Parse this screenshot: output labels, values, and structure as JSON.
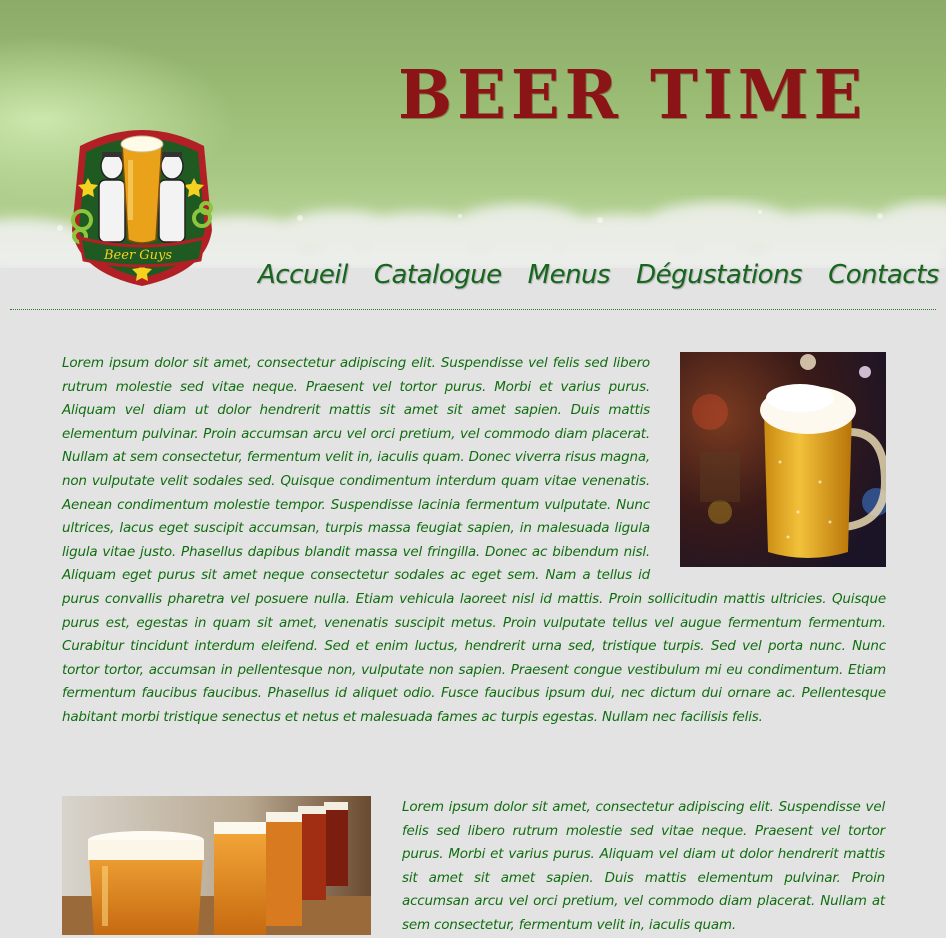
{
  "header": {
    "title": "BEER TIME",
    "logo": {
      "icon": "beer-guys-logo",
      "text": "Beer Guys"
    }
  },
  "nav": {
    "items": [
      {
        "label": "Accueil"
      },
      {
        "label": "Catalogue"
      },
      {
        "label": "Menus"
      },
      {
        "label": "Dégustations"
      },
      {
        "label": "Contacts"
      }
    ]
  },
  "content": {
    "paragraph1": "Lorem ipsum dolor sit amet, consectetur adipiscing elit. Suspendisse vel felis sed libero rutrum molestie sed vitae neque. Praesent vel tortor purus. Morbi et varius purus. Aliquam vel diam ut dolor hendrerit mattis sit amet sit amet sapien. Duis mattis elementum pulvinar. Proin accumsan arcu vel orci pretium, vel commodo diam placerat. Nullam at sem consectetur, fermentum velit in, iaculis quam. Donec viverra risus magna, non vulputate velit sodales sed. Quisque condimentum interdum quam vitae venenatis. Aenean condimentum molestie tempor. Suspendisse lacinia fermentum vulputate. Nunc ultrices, lacus eget suscipit accumsan, turpis massa feugiat sapien, in malesuada ligula ligula vitae justo. Phasellus dapibus blandit massa vel fringilla. Donec ac bibendum nisl. Aliquam eget purus sit amet neque consectetur sodales ac eget sem. Nam a tellus id purus convallis pharetra vel posuere nulla. Etiam vehicula laoreet nisl id mattis. Proin sollicitudin mattis ultricies. Quisque purus est, egestas in quam sit amet, venenatis suscipit metus. Proin vulputate tellus vel augue fermentum fermentum. Curabitur tincidunt interdum eleifend. Sed et enim luctus, hendrerit urna sed, tristique turpis. Sed vel porta nunc. Nunc tortor tortor, accumsan in pellentesque non, vulputate non sapien. Praesent congue vestibulum mi eu condimentum. Etiam fermentum faucibus faucibus. Phasellus id aliquet odio. Fusce faucibus ipsum dui, nec dictum dui ornare ac. Pellentesque habitant morbi tristique senectus et netus et malesuada fames ac turpis egestas. Nullam nec facilisis felis.",
    "paragraph2": "Lorem ipsum dolor sit amet, consectetur adipiscing elit. Suspendisse vel felis sed libero rutrum molestie sed vitae neque. Praesent vel tortor purus. Morbi et varius purus. Aliquam vel diam ut dolor hendrerit mattis sit amet sit amet sapien. Duis mattis elementum pulvinar. Proin accumsan arcu vel orci pretium, vel commodo diam placerat. Nullam at sem consectetur, fermentum velit in, iaculis quam.",
    "image1": {
      "icon": "beer-mug-photo"
    },
    "image2": {
      "icon": "beer-glasses-photo"
    }
  },
  "colors": {
    "title": "#8b1416",
    "nav": "#16661d",
    "text": "#106e10",
    "background": "#e3e3e3",
    "header_green": "#98ba72"
  }
}
